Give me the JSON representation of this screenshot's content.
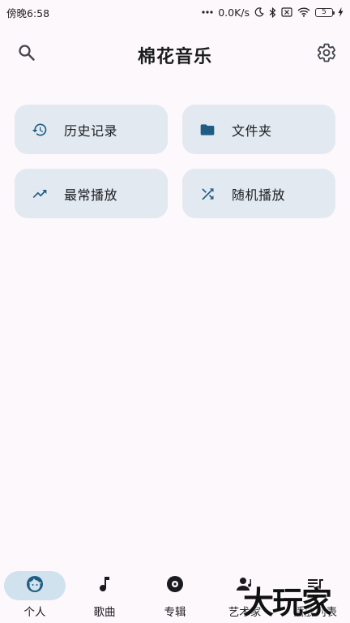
{
  "status_bar": {
    "time": "傍晚6:58",
    "network_speed": "0.0K/s",
    "battery_level": "5",
    "icons": [
      "dots-icon",
      "moon-icon",
      "bluetooth-icon",
      "sim-off-icon",
      "wifi-icon",
      "battery-icon",
      "charging-icon"
    ]
  },
  "app_bar": {
    "title": "棉花音乐",
    "left_icon": "search-icon",
    "right_icon": "settings-gear-icon"
  },
  "quick_actions": [
    {
      "label": "历史记录",
      "icon": "history-icon"
    },
    {
      "label": "文件夹",
      "icon": "folder-icon"
    },
    {
      "label": "最常播放",
      "icon": "trending-up-icon"
    },
    {
      "label": "随机播放",
      "icon": "shuffle-icon"
    }
  ],
  "bottom_nav": {
    "items": [
      {
        "label": "个人",
        "icon": "face-icon",
        "active": true
      },
      {
        "label": "歌曲",
        "icon": "music-note-icon",
        "active": false
      },
      {
        "label": "专辑",
        "icon": "album-disc-icon",
        "active": false
      },
      {
        "label": "艺术家",
        "icon": "artist-icon",
        "active": false
      },
      {
        "label": "播放列表",
        "icon": "playlist-icon",
        "active": false
      }
    ]
  },
  "watermark": "大玩家",
  "colors": {
    "background": "#FDF8FC",
    "card": "#E2E9F0",
    "icon_accent": "#1F5E82",
    "nav_active_pill": "#D0E2EE"
  }
}
